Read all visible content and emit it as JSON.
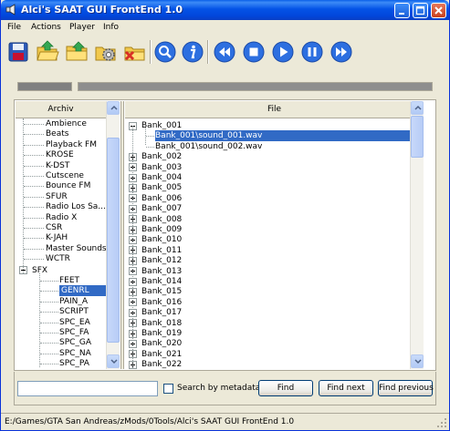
{
  "window": {
    "title": "Alci's SAAT GUI FrontEnd 1.0"
  },
  "menu": [
    "File",
    "Actions",
    "Player",
    "Info"
  ],
  "toolbar": {
    "icons": [
      "save-icon",
      "open-folder-icon",
      "folder-icon",
      "settings-gear-icon",
      "delete-folder-icon",
      "search-icon",
      "info-icon",
      "rewind-icon",
      "stop-icon",
      "play-icon",
      "pause-icon",
      "fast-forward-icon"
    ]
  },
  "progress": {
    "left_fill": 1.0,
    "right_fill": 1.0
  },
  "tree": {
    "header": "Archiv",
    "items": [
      "Ambience",
      "Beats",
      "Playback FM",
      "KROSE",
      "K-DST",
      "Cutscene",
      "Bounce FM",
      "SFUR",
      "Radio Los Sa...",
      "Radio X",
      "CSR",
      "K-JAH",
      "Master Sounds",
      "WCTR"
    ],
    "sfx_root": "SFX",
    "sfx_items": [
      "FEET",
      "GENRL",
      "PAIN_A",
      "SCRIPT",
      "SPC_EA",
      "SPC_FA",
      "SPC_GA",
      "SPC_NA",
      "SPC_PA"
    ],
    "selected": "GENRL"
  },
  "files": {
    "header": "File",
    "expanded_bank": "Bank_001",
    "expanded_children": [
      "Bank_001\\sound_001.wav",
      "Bank_001\\sound_002.wav"
    ],
    "selected": "Bank_001\\sound_001.wav",
    "banks": [
      "Bank_002",
      "Bank_003",
      "Bank_004",
      "Bank_005",
      "Bank_006",
      "Bank_007",
      "Bank_008",
      "Bank_009",
      "Bank_010",
      "Bank_011",
      "Bank_012",
      "Bank_013",
      "Bank_014",
      "Bank_015",
      "Bank_016",
      "Bank_017",
      "Bank_018",
      "Bank_019",
      "Bank_020",
      "Bank_021",
      "Bank_022"
    ]
  },
  "search": {
    "value": "",
    "metadata_label": "Search by metadata",
    "metadata_checked": false,
    "find": "Find",
    "find_next": "Find next",
    "find_previous": "Find previous"
  },
  "status": {
    "path": "E:/Games/GTA San Andreas/zMods/0Tools/Alci's SAAT GUI FrontEnd 1.0"
  },
  "colors": {
    "titlebar": "#0453E6",
    "selection": "#316AC5",
    "toolbar_blue": "#2D6FE0"
  }
}
